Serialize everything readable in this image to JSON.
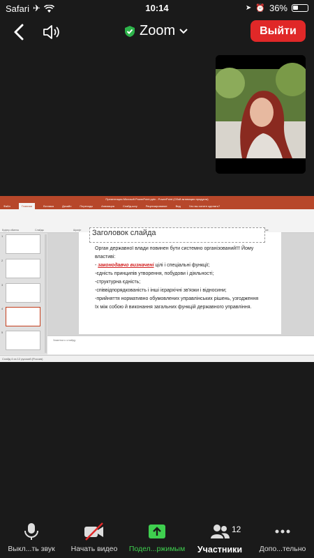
{
  "status_bar": {
    "carrier": "Safari",
    "time": "10:14",
    "battery": "36%"
  },
  "top_bar": {
    "title": "Zoom",
    "leave_label": "Выйти"
  },
  "shared_screen": {
    "window_title": "Презентация Microsoft PowerPoint.pptx - PowerPoint (Сбой активации продукта)",
    "tabs": [
      "Файл",
      "Главная",
      "Вставка",
      "Дизайн",
      "Переходы",
      "Анимация",
      "Слайд-шоу",
      "Рецензирование",
      "Вид",
      "Что вы хотите сделать?"
    ],
    "ribbon_groups": [
      "Буфер обмена",
      "Слайды",
      "Шрифт",
      "Абзац",
      "Рисование",
      "Редактирование"
    ],
    "slide": {
      "heading": "Заголовок слайда",
      "intro": "Орган державної влади повинен бути системно організований!!! Йому властиві:",
      "highlight": "законодавчо визначені",
      "bullet_1_rest": " цілі і спеціальні функції;",
      "bullet_2": "-єдність принципів утворення, побудови і діяльності;",
      "bullet_3": "-структурна єдність;",
      "bullet_4": "-співвідпорядкованість і інші ієрархічні зв'язки і відносини;",
      "bullet_5": "-прийняття нормативно обумовлених управлінських рішень, узгодження їх між собою й виконання загальних функцій державного управління."
    },
    "notes_placeholder": "Заметки к слайду",
    "status": "Слайд 4 из 12    русский (Россия)"
  },
  "toolbar": {
    "mute_label": "Выкл...ть звук",
    "video_label": "Начать видео",
    "share_label": "Подел...ржимым",
    "participants_label": "Участники",
    "participants_count": "12",
    "more_label": "Допо...тельно"
  },
  "colors": {
    "leave_button": "#e02828",
    "share_active": "#3fcf4f",
    "shield": "#2db34a",
    "powerpoint": "#b7472a"
  }
}
